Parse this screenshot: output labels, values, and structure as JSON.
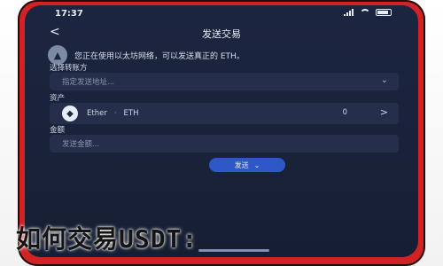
{
  "status": {
    "time": "17:37"
  },
  "header": {
    "back": "<",
    "title": "发送交易"
  },
  "notice": {
    "icon": "info-icon",
    "icon_glyph": "▲",
    "text": "您正在使用以太坊网络，可以发送真正的 ETH。"
  },
  "network": {
    "label": "选择转账方",
    "placeholder": "指定发送地址..."
  },
  "asset": {
    "label": "资产",
    "name": "Ether",
    "symbol": "ETH",
    "balance": "0",
    "icon": "ethereum-icon",
    "icon_glyph": "◆",
    "arrow": ">"
  },
  "amount": {
    "label": "金额",
    "placeholder": "发送金额..."
  },
  "actions": {
    "send": "发送"
  },
  "caption": "如何交易USDT:",
  "colors": {
    "frame": "#d32224",
    "screen": "#1c2540",
    "button": "#2e57c8"
  }
}
